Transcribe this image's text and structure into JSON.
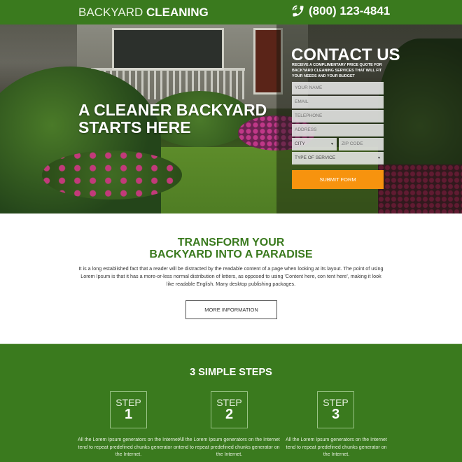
{
  "header": {
    "brand_light": "BACKYARD",
    "brand_bold": "CLEANING",
    "phone_icon": "phone-ringing-icon",
    "phone": "(800) 123-4841"
  },
  "hero": {
    "headline_line1": "A CLEANER BACKYARD",
    "headline_line2": "STARTS HERE"
  },
  "contact_form": {
    "title": "CONTACT US",
    "subtitle": "RECEIVE A COMPLIMENTARY PRICE QUOTE FOR BACKYARD CLEANING SERVICES THAT WILL FIT YOUR NEEDS AND YOUR BUDGET",
    "name_placeholder": "YOUR NAME",
    "email_placeholder": "EMAIL",
    "telephone_placeholder": "TELEPHONE",
    "address_placeholder": "ADDRESS",
    "city_select": "CITY",
    "zip_placeholder": "ZIP CODE",
    "service_select": "TYPE OF SERVICE",
    "submit_label": "SUBMIT FORM",
    "submit_color": "#f7930e"
  },
  "transform": {
    "title_line1": "TRANSFORM YOUR",
    "title_line2": "BACKYARD INTO A PARADISE",
    "body": "It is a long established fact that a reader will be distracted by the readable content of a page when looking at its layout. The point of using Lorem Ipsum is that it has a more-or-less normal distribution of letters, as opposed to using 'Content here, con tent here', making it look like readable English. Many desktop publishing packages.",
    "button_label": "MORE INFORMATION"
  },
  "steps": {
    "title": "3 SIMPLE STEPS",
    "accent_color": "#3a7a1e",
    "items": [
      {
        "word": "STEP",
        "number": "1",
        "text": "All the Lorem Ipsum generators on the Internet tend to repeat predefined chunks generator on the Internet."
      },
      {
        "word": "STEP",
        "number": "2",
        "text": "All the Lorem Ipsum generators on the Internet tend to repeat predefined chunks generator on the Internet."
      },
      {
        "word": "STEP",
        "number": "3",
        "text": "All the Lorem Ipsum generators on the Internet tend to repeat predefined chunks generator on the Internet."
      }
    ]
  }
}
